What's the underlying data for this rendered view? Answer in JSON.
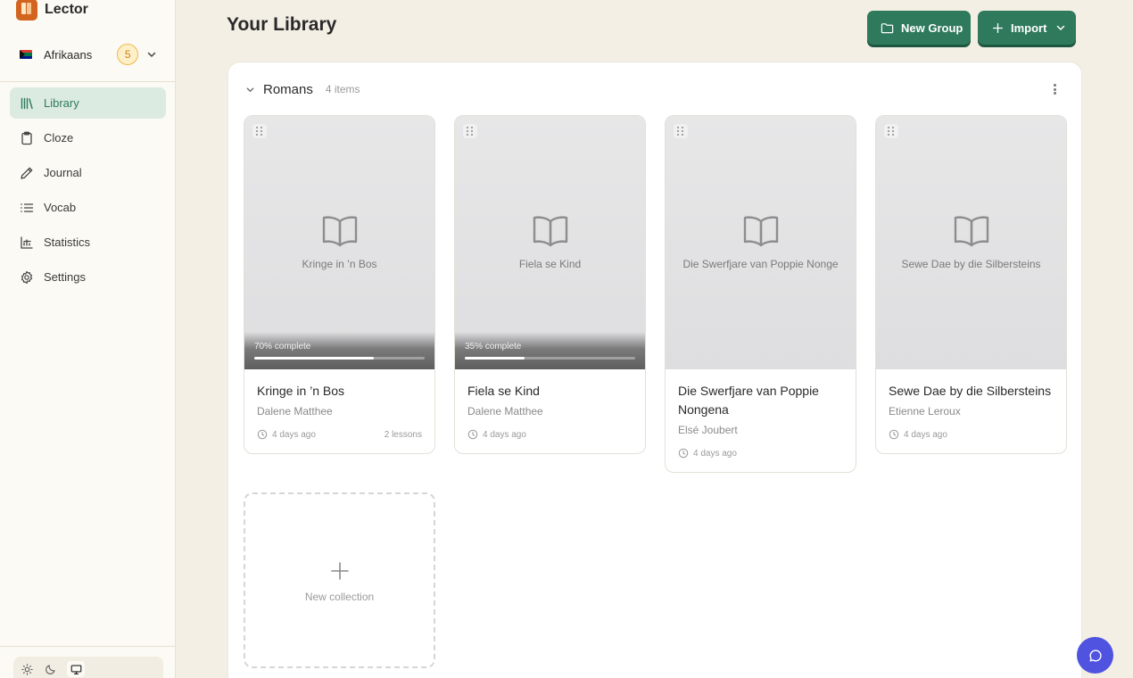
{
  "brand": {
    "name": "Lector"
  },
  "language": {
    "name": "Afrikaans",
    "streak": "5"
  },
  "nav": {
    "items": [
      {
        "label": "Library",
        "icon": "library-icon",
        "active": true
      },
      {
        "label": "Cloze",
        "icon": "clipboard-icon"
      },
      {
        "label": "Journal",
        "icon": "pencil-icon"
      },
      {
        "label": "Vocab",
        "icon": "list-icon"
      },
      {
        "label": "Statistics",
        "icon": "bar-chart-icon"
      },
      {
        "label": "Settings",
        "icon": "gear-icon"
      }
    ]
  },
  "theme": {
    "options": [
      "light",
      "dark",
      "system"
    ],
    "selected": "system"
  },
  "header": {
    "title": "Your Library",
    "new_group_label": "New Group",
    "import_label": "Import"
  },
  "group": {
    "name": "Romans",
    "count": "4 items",
    "items": [
      {
        "title": "Kringe in ’n Bos",
        "cover_title": "Kringe in ’n Bos",
        "author": "Dalene Matthee",
        "time": "4 days ago",
        "lessons": "2 lessons",
        "progress_label": "70% complete",
        "progress": 0.7
      },
      {
        "title": "Fiela se Kind",
        "cover_title": "Fiela se Kind",
        "author": "Dalene Matthee",
        "time": "4 days ago",
        "progress_label": "35% complete",
        "progress": 0.35
      },
      {
        "title": "Die Swerfjare van Poppie Nongena",
        "cover_title": "Die Swerfjare van Poppie Nonge",
        "author": "Elsé Joubert",
        "time": "4 days ago"
      },
      {
        "title": "Sewe Dae by die Silbersteins",
        "cover_title": "Sewe Dae by die Silbersteins",
        "author": "Etienne Leroux",
        "time": "4 days ago"
      }
    ],
    "new_collection_label": "New collection"
  },
  "colors": {
    "accent": "#2f7a5c",
    "chat": "#4f53e0",
    "streak": "#f0b94a"
  }
}
